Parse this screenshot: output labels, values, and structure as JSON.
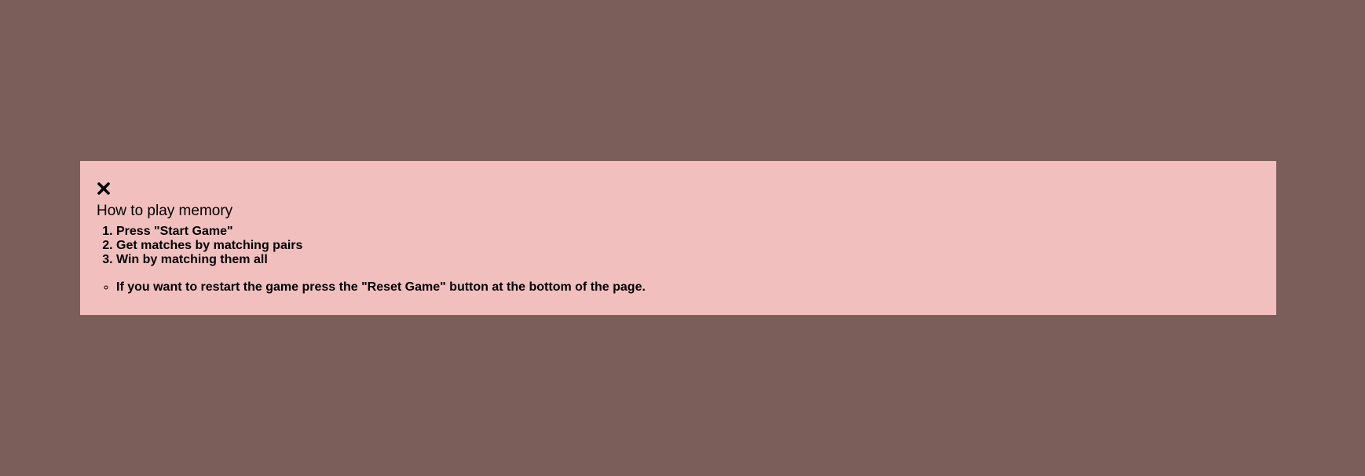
{
  "modal": {
    "close_icon": "close-icon",
    "title": "How to play memory",
    "steps": [
      "Press \"Start Game\"",
      "Get matches by matching pairs",
      "Win by matching them all"
    ],
    "notes": [
      "If you want to restart the game press the \"Reset Game\" button at the bottom of the page."
    ]
  },
  "colors": {
    "backdrop": "#7b5e5a",
    "modal_background": "#f2bfbf",
    "text": "#000000"
  }
}
